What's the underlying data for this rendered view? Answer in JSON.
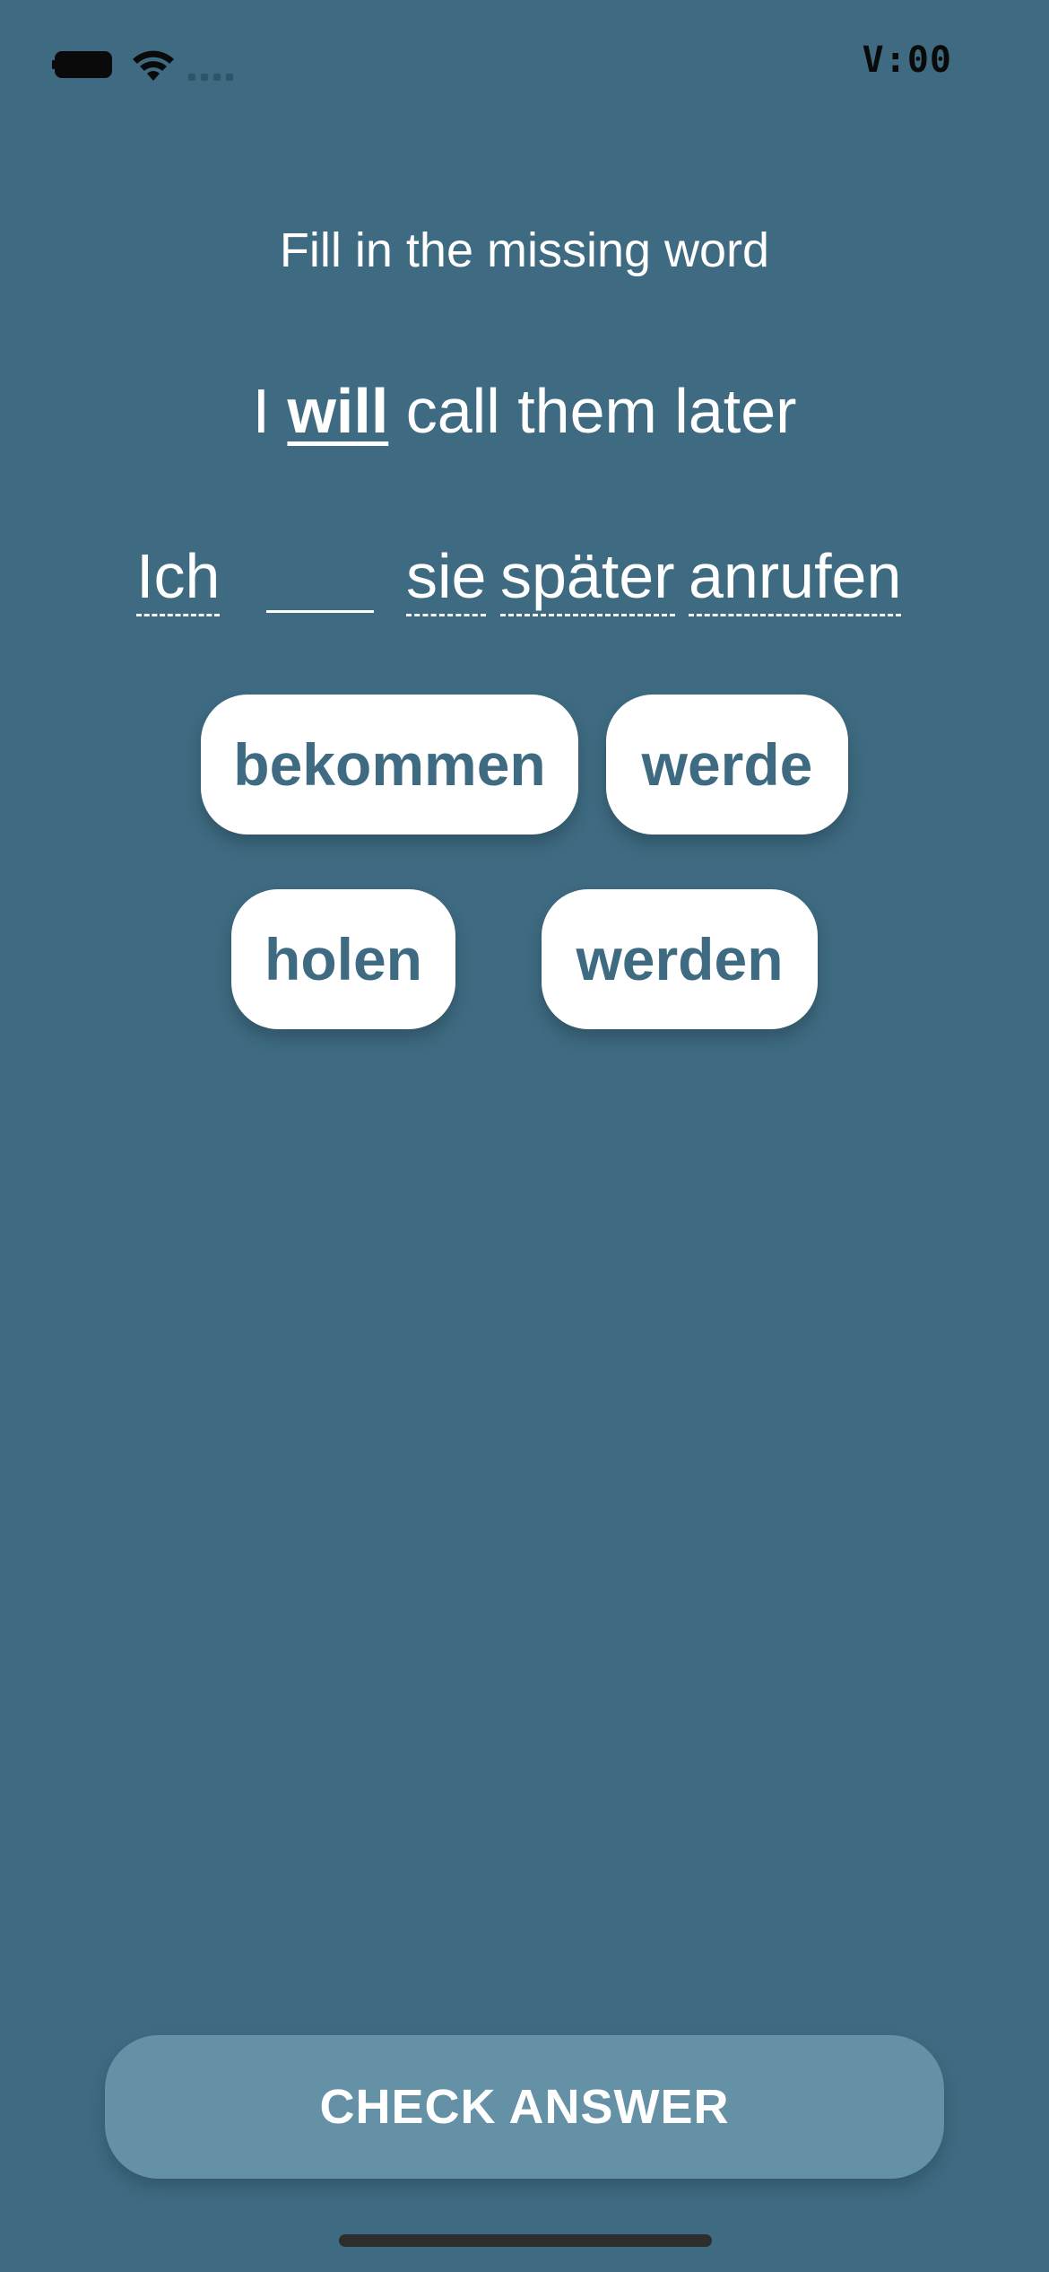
{
  "status_bar": {
    "time": "V:00",
    "battery_icon": "battery-icon",
    "wifi_icon": "wifi-icon",
    "signal_icon": "cellular-signal-icon"
  },
  "exercise": {
    "instruction": "Fill in the missing word",
    "english": {
      "before": "I ",
      "highlight": "will",
      "after": " call them later"
    },
    "german": {
      "words": [
        "Ich",
        "sie",
        "später",
        "anrufen"
      ],
      "blank": "____"
    },
    "options": [
      "bekommen",
      "werde",
      "holen",
      "werden"
    ]
  },
  "actions": {
    "check_label": "CHECK ANSWER"
  },
  "colors": {
    "background": "#3e6b82",
    "chip_text": "#3e6b82",
    "button": "#6491a6"
  }
}
